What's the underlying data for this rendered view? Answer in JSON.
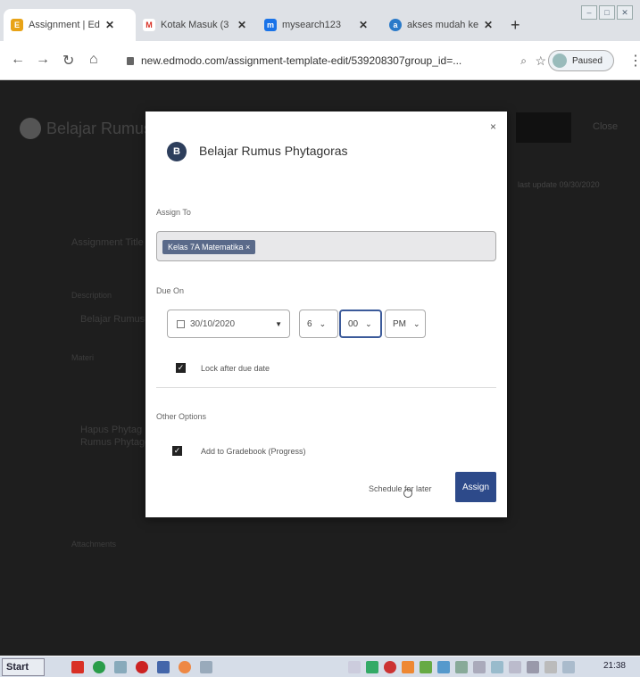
{
  "browser": {
    "tabs": [
      {
        "title": "Assignment | Ed",
        "favicon": "E",
        "color": "#e8a317"
      },
      {
        "title": "Kotak Masuk (3",
        "favicon": "M",
        "color": "#d93025"
      },
      {
        "title": "mysearch123",
        "favicon": "m",
        "color": "#1a73e8"
      },
      {
        "title": "akses mudah ke",
        "favicon": "a",
        "color": "#2a7ac9"
      }
    ],
    "close_glyph": "✕",
    "new_tab_glyph": "+",
    "url": "new.edmodo.com/assignment-template-edit/539208307group_id=...",
    "paused_label": "Paused"
  },
  "page_bg": {
    "title": "Belajar Rumus",
    "close_label": "Close",
    "meta": "last update 09/30/2020",
    "texts": [
      "Assignment Title",
      "Description",
      "Belajar Rumus P",
      "Materi",
      "Hapus Phytag",
      "Rumus Phytagoras",
      "Attachments"
    ]
  },
  "modal": {
    "icon_letter": "B",
    "title": "Belajar Rumus Phytagoras",
    "assign_to_label": "Assign To",
    "assign_chip": "Kelas 7A Matematika ×",
    "due_on_label": "Due On",
    "due_date": "30/10/2020",
    "hour": "6",
    "minute": "00",
    "ampm": "PM",
    "lock_label": "Lock after due date",
    "other_label": "Other Options",
    "gradebook_label": "Add to Gradebook (Progress)",
    "schedule_label": "Schedule for later",
    "assign_button": "Assign",
    "close_glyph": "×"
  },
  "taskbar": {
    "start_label": "Start",
    "time": "21:38"
  }
}
